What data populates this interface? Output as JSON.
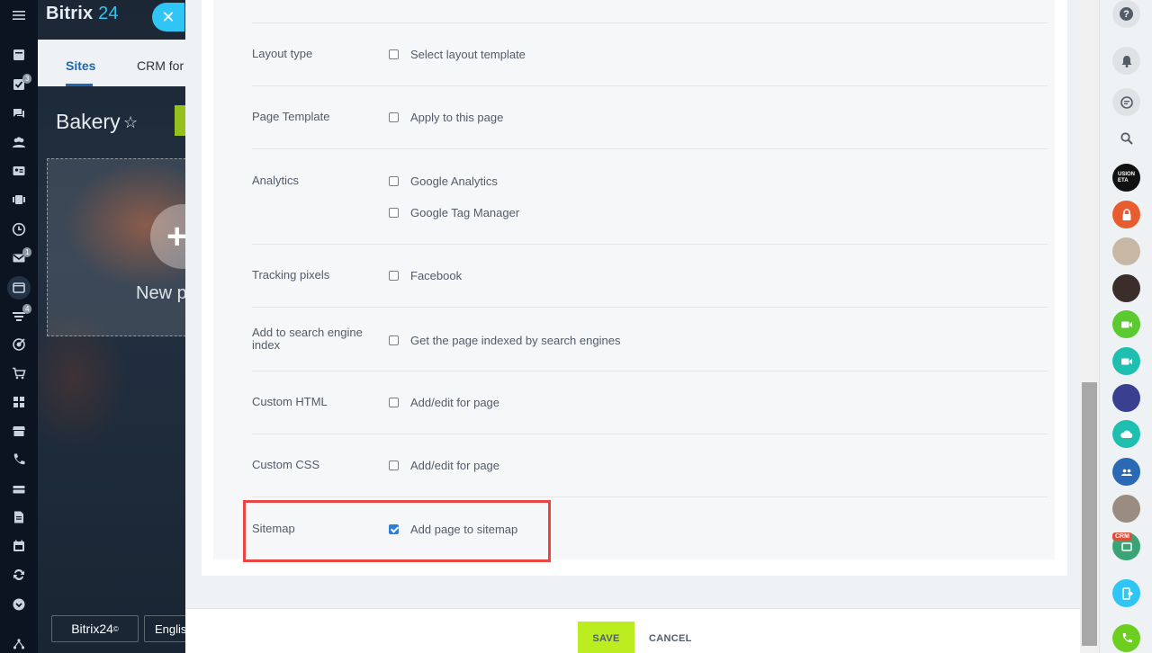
{
  "app": {
    "brand_name": "Bitrix",
    "brand_number": "24",
    "close_icon": "close-icon"
  },
  "left_nav": {
    "badges": [
      "3",
      "1",
      "4"
    ]
  },
  "background": {
    "tabs": [
      {
        "label": "Sites"
      },
      {
        "label": "CRM for"
      }
    ],
    "site_title": "Bakery",
    "new_page_label": "New p",
    "plus": "+",
    "footer_logo": "Bitrix24",
    "footer_logo_mark": "©",
    "language": "Englis"
  },
  "form": {
    "rows": [
      {
        "label": "",
        "options": []
      },
      {
        "label": "Layout type",
        "options": [
          {
            "text": "Select layout template",
            "checked": false
          }
        ]
      },
      {
        "label": "Page Template",
        "options": [
          {
            "text": "Apply to this page",
            "checked": false
          }
        ]
      },
      {
        "label": "Analytics",
        "options": [
          {
            "text": "Google Analytics",
            "checked": false
          },
          {
            "text": "Google Tag Manager",
            "checked": false
          }
        ]
      },
      {
        "label": "Tracking pixels",
        "options": [
          {
            "text": "Facebook",
            "checked": false
          }
        ]
      },
      {
        "label": "Add to search engine index",
        "options": [
          {
            "text": "Get the page indexed by search engines",
            "checked": false
          }
        ]
      },
      {
        "label": "Custom HTML",
        "options": [
          {
            "text": "Add/edit for page",
            "checked": false
          }
        ]
      },
      {
        "label": "Custom CSS",
        "options": [
          {
            "text": "Add/edit for page",
            "checked": false
          }
        ]
      },
      {
        "label": "Sitemap",
        "options": [
          {
            "text": "Add page to sitemap",
            "checked": true
          }
        ]
      }
    ],
    "highlight_color": "#ea4545"
  },
  "footer": {
    "save_label": "SAVE",
    "cancel_label": "CANCEL"
  },
  "right_bar": {
    "help": "?",
    "crm_tag": "CRM",
    "avatar_text": "USION\nETA"
  },
  "colors": {
    "accent": "#2fc6f6",
    "save_button": "#bbed21",
    "checkbox_checked": "#2d7ed8"
  }
}
